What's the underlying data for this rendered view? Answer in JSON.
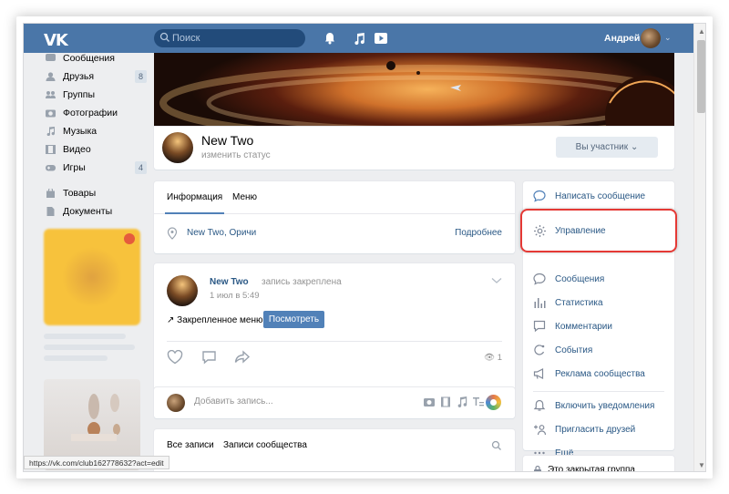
{
  "header": {
    "logo": "VK",
    "search_placeholder": "Поиск",
    "user_name": "Андрей"
  },
  "left_nav": {
    "items": [
      {
        "label": "Сообщения",
        "count": "",
        "icon": "chat-icon"
      },
      {
        "label": "Друзья",
        "count": "8",
        "icon": "user-icon"
      },
      {
        "label": "Группы",
        "count": "",
        "icon": "group-icon"
      },
      {
        "label": "Фотографии",
        "count": "",
        "icon": "camera-icon"
      },
      {
        "label": "Музыка",
        "count": "",
        "icon": "music-icon"
      },
      {
        "label": "Видео",
        "count": "",
        "icon": "film-icon"
      },
      {
        "label": "Игры",
        "count": "4",
        "icon": "gamepad-icon"
      },
      {
        "label": "Товары",
        "count": "",
        "icon": "bag-icon"
      },
      {
        "label": "Документы",
        "count": "",
        "icon": "document-icon"
      }
    ]
  },
  "group": {
    "name": "New Two",
    "status": "изменить статус",
    "member_button": "Вы участник"
  },
  "info": {
    "tabs": [
      "Информация",
      "Меню"
    ],
    "location": "New Two, Оричи",
    "more": "Подробнее"
  },
  "post": {
    "author": "New Two",
    "pinned_note": "запись закреплена",
    "date": "1 июл в 5:49",
    "pinned_menu": "Закрепленное меню",
    "view_button": "Посмотреть",
    "views": "1"
  },
  "composer": {
    "placeholder": "Добавить запись..."
  },
  "wall": {
    "tabs": [
      "Все записи",
      "Записи сообщества"
    ]
  },
  "right_menu": {
    "items": [
      {
        "label": "Написать сообщение",
        "icon": "message-icon"
      },
      {
        "label": "Управление",
        "icon": "gear-icon"
      },
      {
        "label": "Сообщения",
        "icon": "chat-icon"
      },
      {
        "label": "Статистика",
        "icon": "stats-icon"
      },
      {
        "label": "Комментарии",
        "icon": "comment-icon"
      },
      {
        "label": "События",
        "icon": "event-icon"
      },
      {
        "label": "Реклама сообщества",
        "icon": "megaphone-icon"
      },
      {
        "label": "Включить уведомления",
        "icon": "bell-icon"
      },
      {
        "label": "Пригласить друзей",
        "icon": "invite-icon"
      },
      {
        "label": "Ещё",
        "icon": "more-icon"
      }
    ],
    "closed_group": "Это закрытая группа"
  },
  "status_bar": {
    "url": "https://vk.com/club162778632?act=edit"
  },
  "colors": {
    "brand": "#4a76a8",
    "link": "#2a5885",
    "button": "#5181b8",
    "highlight": "#e53935"
  }
}
